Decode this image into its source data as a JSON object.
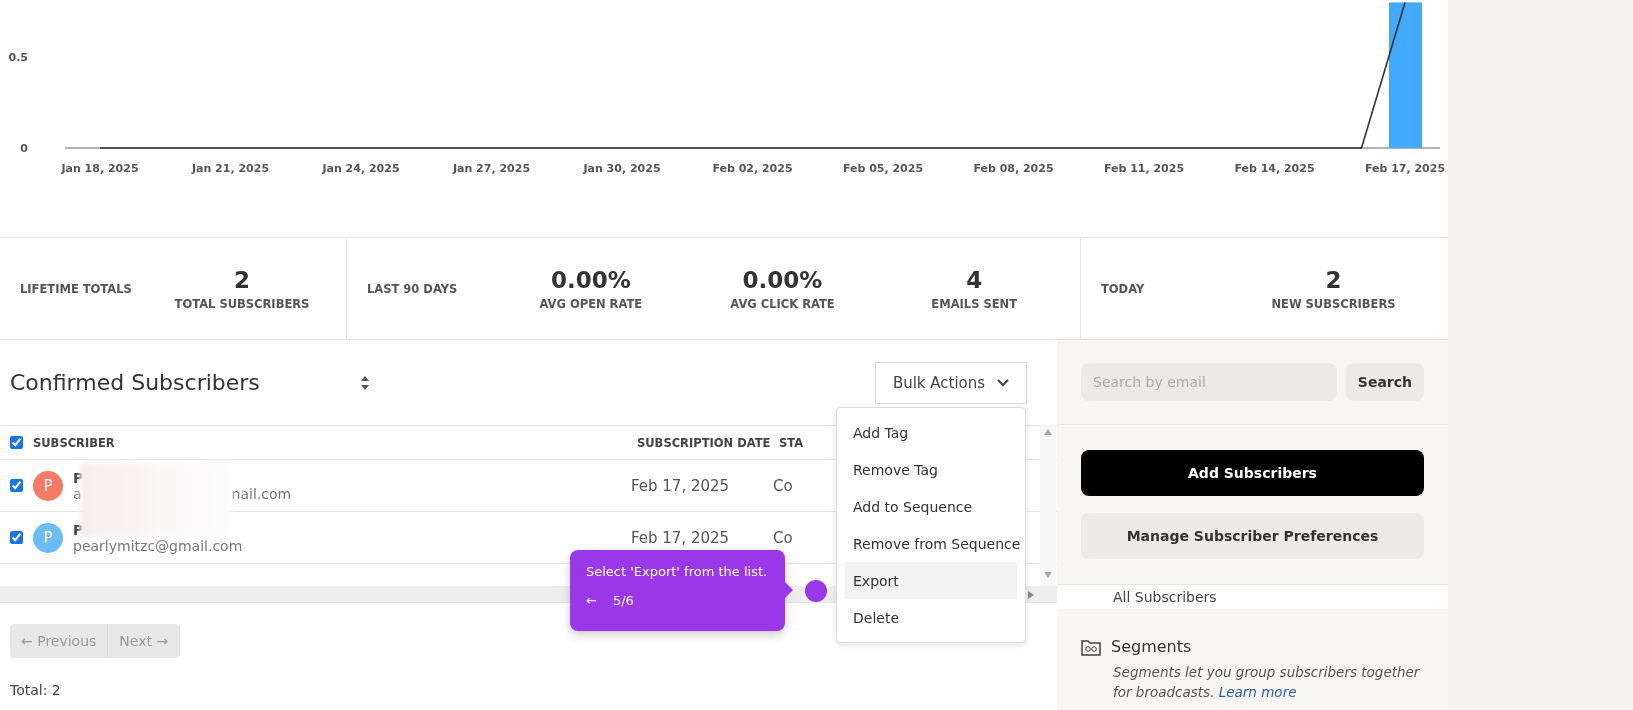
{
  "chart": {
    "chart_data": {
      "type": "bar",
      "categories": [
        "Jan 18, 2025",
        null,
        null,
        "Jan 21, 2025",
        null,
        null,
        "Jan 24, 2025",
        null,
        null,
        "Jan 27, 2025",
        null,
        null,
        "Jan 30, 2025",
        null,
        null,
        "Feb 02, 2025",
        null,
        null,
        "Feb 05, 2025",
        null,
        null,
        "Feb 08, 2025",
        null,
        null,
        "Feb 11, 2025",
        null,
        null,
        "Feb 14, 2025",
        null,
        null,
        "Feb 17, 2025"
      ],
      "series": [
        {
          "color": "#42aaff",
          "values": [
            0,
            0,
            0,
            0,
            0,
            0,
            0,
            0,
            0,
            0,
            0,
            0,
            0,
            0,
            0,
            0,
            0,
            0,
            0,
            0,
            0,
            0,
            0,
            0,
            0,
            0,
            0,
            0,
            0,
            0,
            0.8
          ]
        },
        {
          "type": "line",
          "color": "#333333",
          "values": [
            0,
            0,
            0,
            0,
            0,
            0,
            0,
            0,
            0,
            0,
            0,
            0,
            0,
            0,
            0,
            0,
            0,
            0,
            0,
            0,
            0,
            0,
            0,
            0,
            0,
            0,
            0,
            0,
            0,
            0,
            0.8
          ]
        }
      ],
      "ylim": [
        0,
        0.8
      ],
      "yticks": [
        0,
        0.5
      ]
    }
  },
  "stats": [
    {
      "label": "LIFETIME TOTALS",
      "metrics": [
        {
          "value": "2",
          "label": "TOTAL SUBSCRIBERS"
        }
      ]
    },
    {
      "label": "LAST 90 DAYS",
      "metrics": [
        {
          "value": "0.00%",
          "label": "AVG OPEN RATE"
        },
        {
          "value": "0.00%",
          "label": "AVG CLICK RATE"
        },
        {
          "value": "4",
          "label": "EMAILS SENT"
        }
      ]
    },
    {
      "label": "TODAY",
      "metrics": [
        {
          "value": "2",
          "label": "NEW SUBSCRIBERS"
        }
      ]
    }
  ],
  "list": {
    "title": "Confirmed Subscribers",
    "bulk_actions": "Bulk Actions",
    "select_all_checked": true,
    "columns": [
      "SUBSCRIBER",
      "SUBSCRIPTION DATE",
      "STA"
    ],
    "rows": [
      {
        "checked": true,
        "avatar": "P",
        "color": "#f47c64",
        "name": "P",
        "email_parts": [
          "a",
          "nail.com"
        ],
        "date": "Feb 17, 2025",
        "status": "Co"
      },
      {
        "checked": true,
        "avatar": "P",
        "color": "#6cbcf5",
        "name": "P",
        "email_parts": [
          "pearlymitzc@gmail.com"
        ],
        "date": "Feb 17, 2025",
        "status": "Co"
      }
    ]
  },
  "menu": [
    {
      "label": "Add Tag",
      "selected": false
    },
    {
      "label": "Remove Tag",
      "selected": false
    },
    {
      "label": "Add to Sequence",
      "selected": false
    },
    {
      "label": "Remove from Sequence",
      "selected": false
    },
    {
      "label": "Export",
      "selected": true
    },
    {
      "label": "Delete",
      "selected": false
    }
  ],
  "tooltip": {
    "text": "Select 'Export' from the list.",
    "back": "←",
    "step": "5/6"
  },
  "pagination": [
    {
      "label": "← Previous",
      "disabled": true
    },
    {
      "label": "Next →",
      "disabled": true
    }
  ],
  "total": "Total: 2",
  "sidebar": {
    "search": {
      "placeholder": "Search by email"
    },
    "search_button": "Search",
    "add_button": "Add Subscribers",
    "manage_button": "Manage Subscriber Preferences",
    "all_subscribers": "All Subscribers",
    "segments": {
      "title": "Segments",
      "description": "Segments let you group subscribers together for broadcasts.",
      "link": "Learn more"
    }
  }
}
